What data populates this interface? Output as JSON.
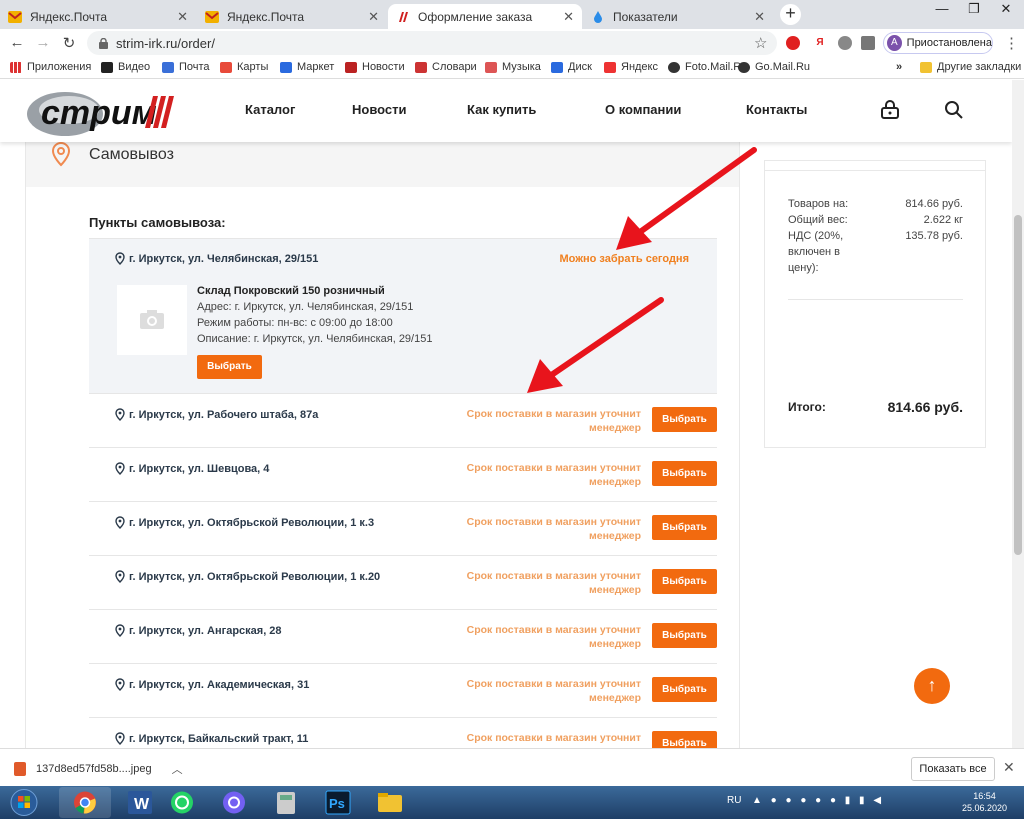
{
  "tabs": [
    {
      "title": "Яндекс.Почта",
      "icon": "yandex-mail-icon"
    },
    {
      "title": "Яндекс.Почта",
      "icon": "yandex-mail-icon"
    },
    {
      "title": "Оформление заказа",
      "icon": "strim-icon"
    },
    {
      "title": "Показатели",
      "icon": "drop-icon"
    }
  ],
  "window": {
    "minimize": "—",
    "maximize": "❐",
    "close": "✕"
  },
  "address": {
    "url": "strim-irk.ru/order/"
  },
  "profile": {
    "initial": "A",
    "label": "Приостановлена"
  },
  "bookmarks": [
    {
      "label": "Приложения"
    },
    {
      "label": "Видео"
    },
    {
      "label": "Почта"
    },
    {
      "label": "Карты"
    },
    {
      "label": "Маркет"
    },
    {
      "label": "Новости"
    },
    {
      "label": "Словари"
    },
    {
      "label": "Музыка"
    },
    {
      "label": "Диск"
    },
    {
      "label": "Яндекс"
    },
    {
      "label": "Foto.Mail.Ru"
    },
    {
      "label": "Go.Mail.Ru"
    }
  ],
  "bookmarks_more": "»",
  "other_bookmarks": "Другие закладки",
  "site": {
    "logo_text": "стрим",
    "menu": [
      "Каталог",
      "Новости",
      "Как купить",
      "О компании",
      "Контакты"
    ]
  },
  "section": {
    "title": "Самовывоз",
    "points_label": "Пункты самовывоза:",
    "expanded": {
      "address": "г. Иркутск, ул. Челябинская, 29/151",
      "status": "Можно забрать сегодня",
      "warehouse": "Склад Покровский 150 розничный",
      "addr_line": "Адрес: г. Иркутск, ул. Челябинская, 29/151",
      "hours": "Режим работы: пн-вс: с 09:00 до 18:00",
      "desc": "Описание: г. Иркутск, ул. Челябинская, 29/151",
      "button": "Выбрать"
    },
    "points": [
      {
        "address": "г. Иркутск, ул. Рабочего штаба, 87а",
        "status": "Срок поставки в магазин уточнит менеджер",
        "button": "Выбрать"
      },
      {
        "address": "г. Иркутск, ул. Шевцова, 4",
        "status": "Срок поставки в магазин уточнит менеджер",
        "button": "Выбрать"
      },
      {
        "address": "г. Иркутск, ул. Октябрьской Революции, 1 к.3",
        "status": "Срок поставки в магазин уточнит менеджер",
        "button": "Выбрать"
      },
      {
        "address": "г. Иркутск, ул. Октябрьской Революции, 1 к.20",
        "status": "Срок поставки в магазин уточнит менеджер",
        "button": "Выбрать"
      },
      {
        "address": "г. Иркутск, ул. Ангарская, 28",
        "status": "Срок поставки в магазин уточнит менеджер",
        "button": "Выбрать"
      },
      {
        "address": "г. Иркутск, ул. Академическая, 31",
        "status": "Срок поставки в магазин уточнит менеджер",
        "button": "Выбрать"
      },
      {
        "address": "г. Иркутск, Байкальский тракт, 11",
        "status": "Срок поставки в магазин уточнит менеджер",
        "button": "Выбрать"
      }
    ]
  },
  "summary": {
    "goods_label": "Товаров на:",
    "goods_value": "814.66 руб.",
    "weight_label": "Общий вес:",
    "weight_value": "2.622 кг",
    "vat_label": "НДС (20%, включен в цену):",
    "vat_value": "135.78 руб.",
    "total_label": "Итого:",
    "total_value": "814.66 руб."
  },
  "download": {
    "file": "137d8ed57fd58b....jpeg",
    "show_all": "Показать все"
  },
  "taskbar": {
    "lang": "RU",
    "time": "16:54",
    "date": "25.06.2020"
  },
  "colors": {
    "accent": "#f26a0f",
    "arrow": "#e8141c",
    "status_orange": "#f0a060"
  }
}
